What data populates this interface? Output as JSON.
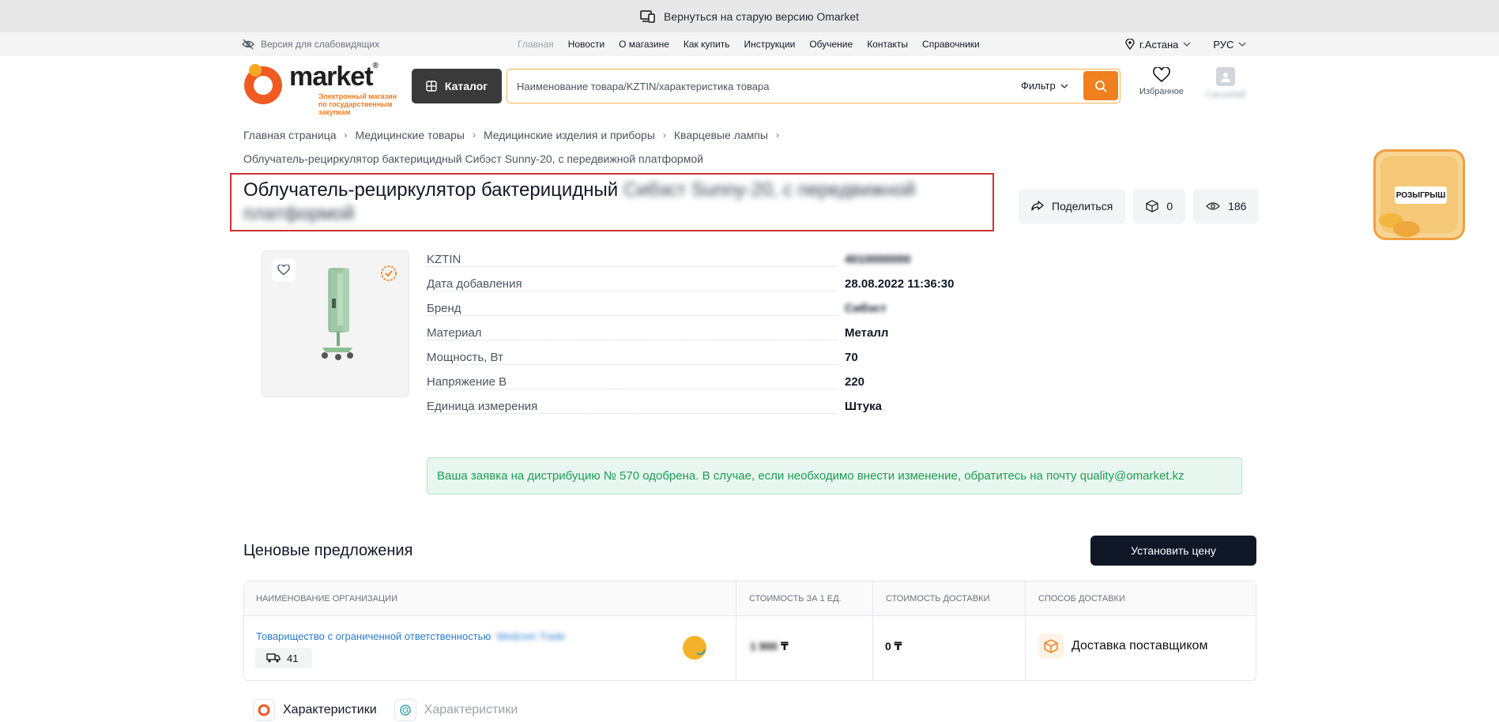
{
  "banner": {
    "text": "Вернуться на старую версию Omarket"
  },
  "subbar": {
    "vision": "Версия для слабовидящих",
    "nav": [
      "Главная",
      "Новости",
      "О магазине",
      "Как купить",
      "Инструкции",
      "Обучение",
      "Контакты",
      "Справочники"
    ],
    "city": "г.Астана",
    "lang": "РУС"
  },
  "header": {
    "logo_word": "market",
    "logo_tagline": "Электронный магазин по государственным закупкам",
    "catalog_label": "Каталог",
    "search_placeholder": "Наименование товара/KZTIN/характеристика товара",
    "filter_label": "Фильтр",
    "favorites_label": "Избранное",
    "user_label": "Сасыкбай"
  },
  "breadcrumb": [
    "Главная страница",
    "Медицинские товары",
    "Медицинские изделия и приборы",
    "Кварцевые лампы"
  ],
  "breadcrumb_last": "Облучатель-рециркулятор бактерицидный Сибэст Sunny-20, с передвижной платформой",
  "product": {
    "title_visible": "Облучатель-рециркулятор бактерицидный",
    "title_blurred": "Сибэст Sunny-20, с передвижной платформой",
    "share_label": "Поделиться",
    "box_count": "0",
    "views": "186"
  },
  "promo": {
    "label": "РОЗЫГРЫШ"
  },
  "specs": [
    {
      "key": "KZTIN",
      "value": "4010000000",
      "blurred": true
    },
    {
      "key": "Дата добавления",
      "value": "28.08.2022 11:36:30",
      "blurred": false
    },
    {
      "key": "Бренд",
      "value": "Сибэст",
      "blurred": true
    },
    {
      "key": "Материал",
      "value": "Металл",
      "blurred": false
    },
    {
      "key": "Мощность, Вт",
      "value": "70",
      "blurred": false
    },
    {
      "key": "Напряжение В",
      "value": "220",
      "blurred": false
    },
    {
      "key": "Единица измерения",
      "value": "Штука",
      "blurred": false
    }
  ],
  "notice": "Ваша заявка на дистрибуцию № 570 одобрена. В случае, если необходимо внести изменение, обратитесь на почту quality@omarket.kz",
  "offers": {
    "title": "Ценовые предложения",
    "set_price_label": "Установить цену",
    "columns": [
      "Наименование организации",
      "Стоимость за 1 ед.",
      "Стоимость доставки",
      "Способ доставки"
    ],
    "row": {
      "org": "Товарищество с ограниченной ответственностью",
      "org_blurred": "Medcom Trade",
      "trucks": "41",
      "price_blurred": "1 900",
      "price_currency": "₸",
      "delivery_cost": "0 ₸",
      "delivery_method": "Доставка поставщиком"
    }
  },
  "tabs": [
    "Характеристики",
    "Характеристики"
  ]
}
